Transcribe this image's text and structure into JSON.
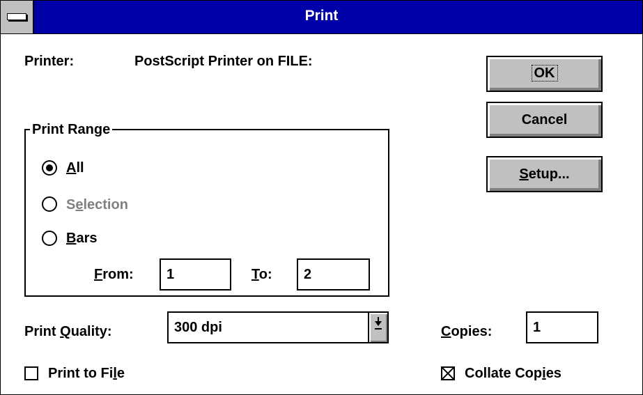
{
  "window": {
    "title": "Print"
  },
  "printer": {
    "label": "Printer:",
    "value": "PostScript Printer on FILE:"
  },
  "buttons": {
    "ok": "OK",
    "cancel": "Cancel",
    "setup": "Setup..."
  },
  "print_range": {
    "legend": "Print Range",
    "options": [
      {
        "label": "All",
        "selected": true,
        "enabled": true
      },
      {
        "label": "Selection",
        "selected": false,
        "enabled": false
      },
      {
        "label": "Bars",
        "selected": false,
        "enabled": true
      }
    ],
    "from_label": "From:",
    "from_value": "1",
    "to_label": "To:",
    "to_value": "2"
  },
  "quality": {
    "label": "Print Quality:",
    "value": "300 dpi"
  },
  "copies": {
    "label": "Copies:",
    "value": "1"
  },
  "print_to_file": {
    "label": "Print to File",
    "checked": false
  },
  "collate": {
    "label": "Collate Copies",
    "checked": true
  },
  "colors": {
    "titlebar": "#0000a8",
    "face": "#c0c0c0",
    "disabled_text": "#808080"
  }
}
